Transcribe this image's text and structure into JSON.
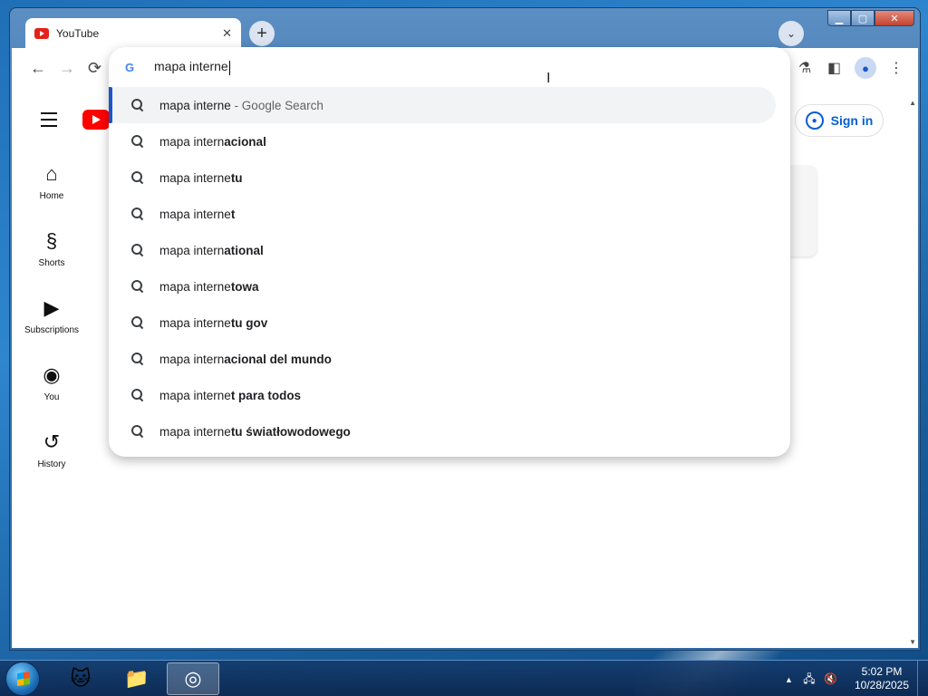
{
  "browser": {
    "tab_title": "YouTube",
    "new_tab_symbol": "+",
    "tab_search_symbol": "⌄",
    "window_controls": {
      "minimize": "▁",
      "maximize": "▢",
      "close": "✕"
    }
  },
  "toolbar": {
    "back": "←",
    "forward": "→",
    "reload": "⟳",
    "labs_icon": "⚗",
    "sidepanel_icon": "◧",
    "menu_icon": "⋮"
  },
  "omnibox": {
    "engine_icon": "G",
    "typed_text": "mapa interne",
    "suggestions": [
      {
        "prefix": "mapa interne",
        "bold": "",
        "suffix": " - Google Search"
      },
      {
        "prefix": "mapa intern",
        "bold": "acional",
        "suffix": ""
      },
      {
        "prefix": "mapa interne",
        "bold": "tu",
        "suffix": ""
      },
      {
        "prefix": "mapa interne",
        "bold": "t",
        "suffix": ""
      },
      {
        "prefix": "mapa intern",
        "bold": "ational",
        "suffix": ""
      },
      {
        "prefix": "mapa interne",
        "bold": "towa",
        "suffix": ""
      },
      {
        "prefix": "mapa interne",
        "bold": "tu gov",
        "suffix": ""
      },
      {
        "prefix": "mapa intern",
        "bold": "acional del mundo",
        "suffix": ""
      },
      {
        "prefix": "mapa interne",
        "bold": "t para todos",
        "suffix": ""
      },
      {
        "prefix": "mapa interne",
        "bold": "tu światłowodowego",
        "suffix": ""
      }
    ]
  },
  "youtube": {
    "sidebar": [
      {
        "label": "Home",
        "icon": "⌂"
      },
      {
        "label": "Shorts",
        "icon": "§"
      },
      {
        "label": "Subscriptions",
        "icon": "▶"
      },
      {
        "label": "You",
        "icon": "◉"
      },
      {
        "label": "History",
        "icon": "↺"
      }
    ],
    "sign_in_label": "Sign in"
  },
  "taskbar": {
    "apps": [
      {
        "name": "cat-app-icon",
        "glyph": "🐱"
      },
      {
        "name": "file-explorer-icon",
        "glyph": "📁"
      },
      {
        "name": "chrome-icon",
        "glyph": "◎"
      }
    ],
    "tray_arrow": "▲",
    "network_icon": "🖧",
    "volume_icon": "🔇",
    "time": "5:02 PM",
    "date": "10/28/2025"
  },
  "colors": {
    "youtube_red": "#ff0000",
    "link_blue": "#065fd4",
    "selected_bar": "#1a56c4"
  }
}
